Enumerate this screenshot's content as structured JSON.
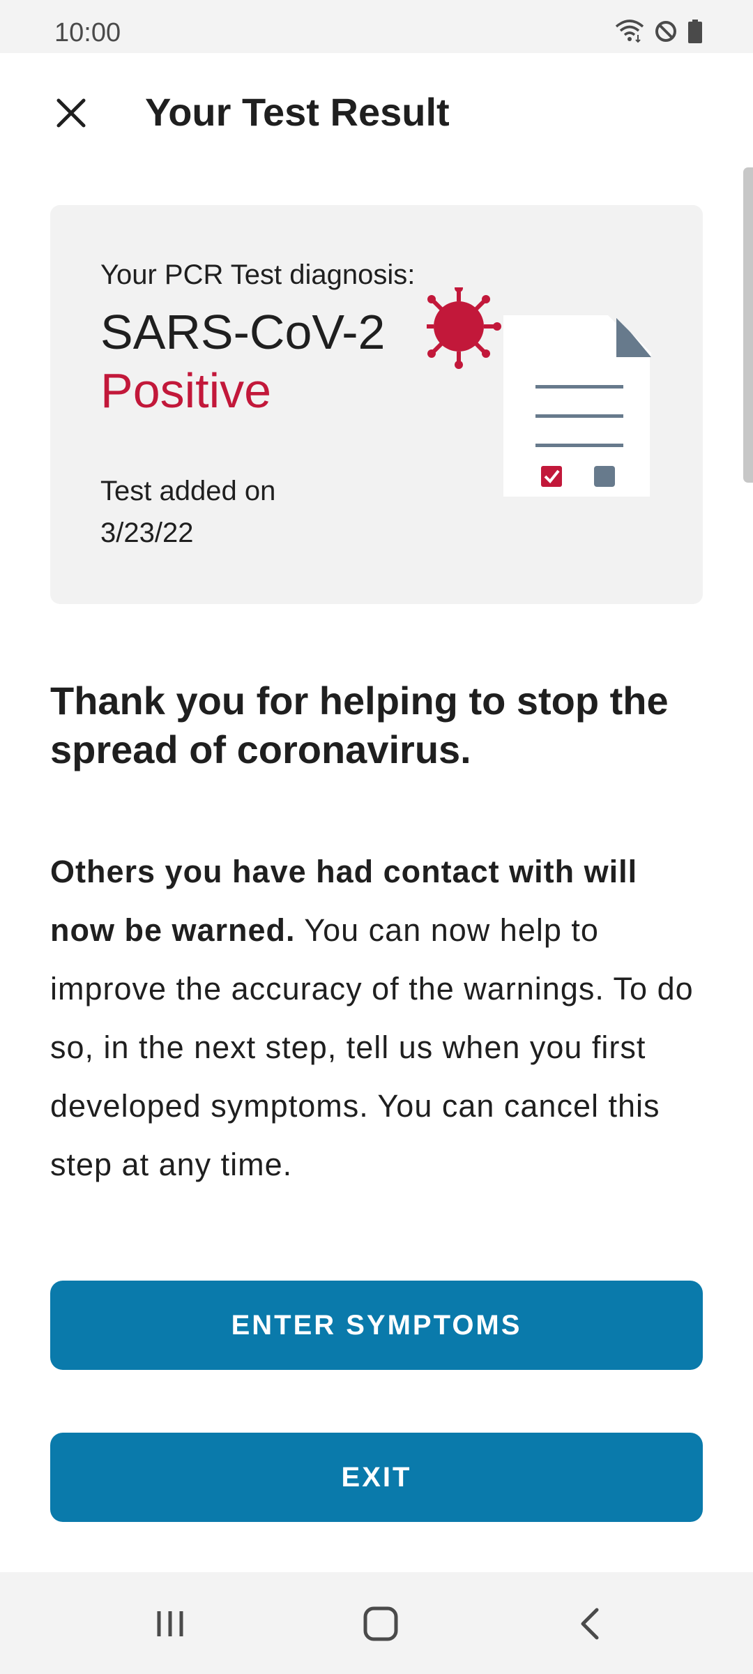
{
  "status_bar": {
    "time": "10:00",
    "icons": [
      "wifi-icon",
      "do-not-disturb-icon",
      "battery-icon"
    ]
  },
  "app_bar": {
    "title": "Your Test Result",
    "close_icon": "close-icon"
  },
  "result_card": {
    "label": "Your PCR Test diagnosis:",
    "virus": "SARS-CoV-2",
    "result": "Positive",
    "date_label": "Test added on",
    "date": "3/23/22",
    "illustration": "test-document-virus-illustration"
  },
  "content": {
    "headline": "Thank you for helping to stop the spread of coronavirus.",
    "body_bold": "Others you have had contact with will now be warned.",
    "body_rest": " You can now help to improve the accuracy of the warnings. To do so, in the next step, tell us when you first developed symptoms. You can cancel this step at any time."
  },
  "buttons": {
    "enter_symptoms": "ENTER SYMPTOMS",
    "exit": "EXIT"
  },
  "nav_bar": {
    "icons": [
      "recent-apps-icon",
      "home-icon",
      "back-icon"
    ]
  },
  "colors": {
    "accent": "#0a7aab",
    "positive": "#c2183a",
    "card_background": "#f2f2f2",
    "doc_gray": "#677a8c"
  }
}
